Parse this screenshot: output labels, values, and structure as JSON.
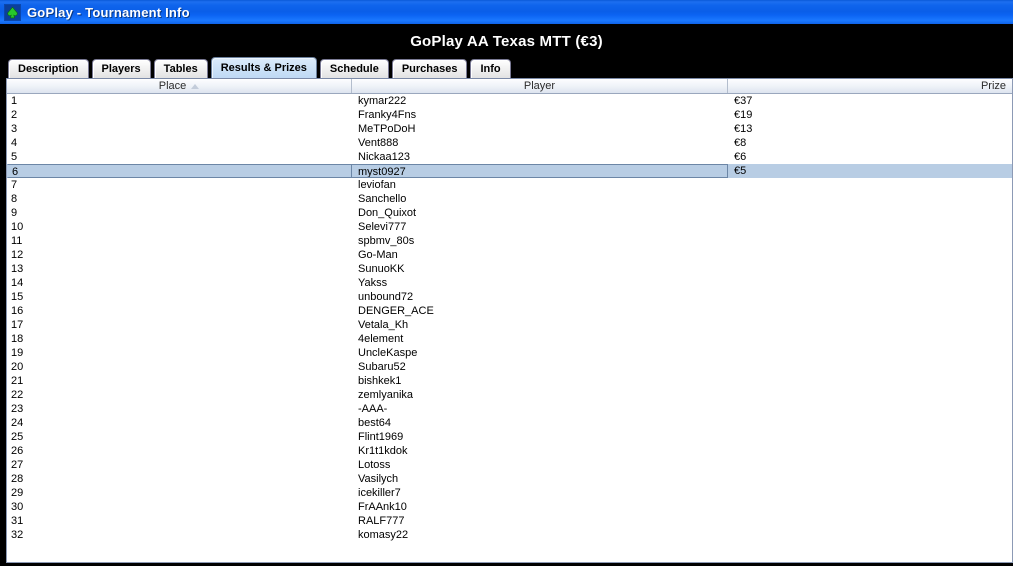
{
  "window": {
    "title": "GoPlay - Tournament Info",
    "icon": "spade-icon"
  },
  "header": {
    "title": "GoPlay AA Texas MTT (€3)"
  },
  "tabs": [
    {
      "label": "Description",
      "selected": false
    },
    {
      "label": "Players",
      "selected": false
    },
    {
      "label": "Tables",
      "selected": false
    },
    {
      "label": "Results & Prizes",
      "selected": true
    },
    {
      "label": "Schedule",
      "selected": false
    },
    {
      "label": "Purchases",
      "selected": false
    },
    {
      "label": "Info",
      "selected": false
    }
  ],
  "table": {
    "columns": [
      {
        "label": "Place",
        "sort": "ascending",
        "sort_icon": "sort-ascending-icon"
      },
      {
        "label": "Player",
        "sort": "none"
      },
      {
        "label": "Prize",
        "sort": "none"
      }
    ],
    "selected_row_index": 5,
    "rows": [
      {
        "place": "1",
        "player": "kymar222",
        "prize": "€37"
      },
      {
        "place": "2",
        "player": "Franky4Fns",
        "prize": "€19"
      },
      {
        "place": "3",
        "player": "MeTPoDoH",
        "prize": "€13"
      },
      {
        "place": "4",
        "player": "Vent888",
        "prize": "€8"
      },
      {
        "place": "5",
        "player": "Nickaa123",
        "prize": "€6"
      },
      {
        "place": "6",
        "player": "myst0927",
        "prize": "€5"
      },
      {
        "place": "7",
        "player": "leviofan",
        "prize": ""
      },
      {
        "place": "8",
        "player": "Sanchello",
        "prize": ""
      },
      {
        "place": "9",
        "player": "Don_Quixot",
        "prize": ""
      },
      {
        "place": "10",
        "player": "Selevi777",
        "prize": ""
      },
      {
        "place": "11",
        "player": "spbmv_80s",
        "prize": ""
      },
      {
        "place": "12",
        "player": "Go-Man",
        "prize": ""
      },
      {
        "place": "13",
        "player": "SunuoKK",
        "prize": ""
      },
      {
        "place": "14",
        "player": "Yakss",
        "prize": ""
      },
      {
        "place": "15",
        "player": "unbound72",
        "prize": ""
      },
      {
        "place": "16",
        "player": "DENGER_ACE",
        "prize": ""
      },
      {
        "place": "17",
        "player": "Vetala_Kh",
        "prize": ""
      },
      {
        "place": "18",
        "player": "4element",
        "prize": ""
      },
      {
        "place": "19",
        "player": "UncleKaspe",
        "prize": ""
      },
      {
        "place": "20",
        "player": "Subaru52",
        "prize": ""
      },
      {
        "place": "21",
        "player": "bishkek1",
        "prize": ""
      },
      {
        "place": "22",
        "player": "zemlyanika",
        "prize": ""
      },
      {
        "place": "23",
        "player": "-AAA-",
        "prize": ""
      },
      {
        "place": "24",
        "player": "best64",
        "prize": ""
      },
      {
        "place": "25",
        "player": "Flint1969",
        "prize": ""
      },
      {
        "place": "26",
        "player": "Kr1t1kdok",
        "prize": ""
      },
      {
        "place": "27",
        "player": "Lotoss",
        "prize": ""
      },
      {
        "place": "28",
        "player": "Vasilych",
        "prize": ""
      },
      {
        "place": "29",
        "player": "icekiller7",
        "prize": ""
      },
      {
        "place": "30",
        "player": "FrAAnk10",
        "prize": ""
      },
      {
        "place": "31",
        "player": "RALF777",
        "prize": ""
      },
      {
        "place": "32",
        "player": "komasy22",
        "prize": ""
      }
    ]
  },
  "colors": {
    "titlebar_blue": "#0f64ec",
    "tab_selected": "#cde2f7",
    "row_selected": "#b8cde4",
    "grid_border": "#8c9ab5"
  }
}
